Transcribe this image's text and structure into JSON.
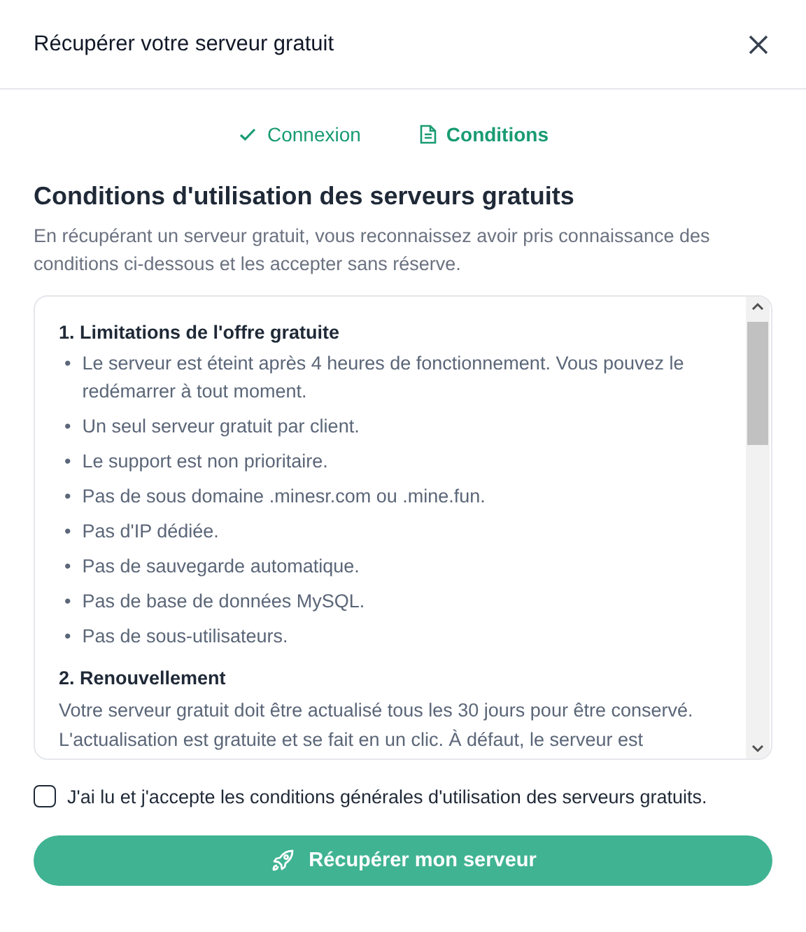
{
  "dialog": {
    "title": "Récupérer votre serveur gratuit"
  },
  "steps": [
    {
      "label": "Connexion",
      "completed": true,
      "selected": false
    },
    {
      "label": "Conditions",
      "completed": false,
      "selected": true
    }
  ],
  "heading": "Conditions d'utilisation des serveurs gratuits",
  "intro": "En récupérant un serveur gratuit, vous reconnaissez avoir pris connaissance des conditions ci-dessous et les accepter sans réserve.",
  "terms": [
    {
      "title": "1. Limitations de l'offre gratuite",
      "marker": "•",
      "items": [
        "Le serveur est éteint après 4 heures de fonctionnement. Vous pouvez le redémarrer à tout moment.",
        "Un seul serveur gratuit par client.",
        "Le support est non prioritaire.",
        "Pas de sous domaine .minesr.com ou .mine.fun.",
        "Pas d'IP dédiée.",
        "Pas de sauvegarde automatique.",
        "Pas de base de données MySQL.",
        "Pas de sous-utilisateurs."
      ]
    },
    {
      "title": "2. Renouvellement",
      "text": "Votre serveur gratuit doit être actualisé tous les 30 jours pour être conservé. L'actualisation est gratuite et se fait en un clic. À défaut, le serveur est"
    }
  ],
  "agreement": {
    "label": "J'ai lu et j'accepte les conditions générales d'utilisation des serveurs gratuits.",
    "checked": false
  },
  "submit": {
    "label": "Récupérer mon serveur"
  }
}
